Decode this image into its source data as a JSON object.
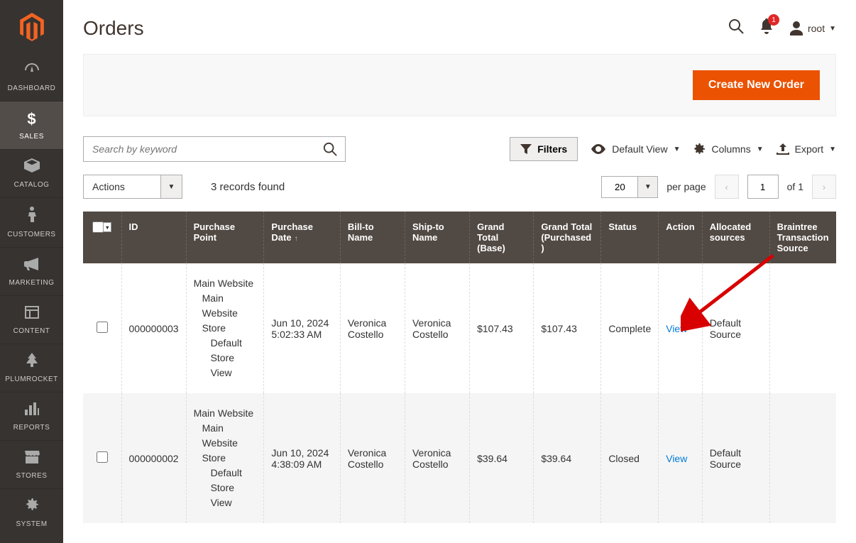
{
  "sidebar": {
    "items": [
      {
        "label": "DASHBOARD",
        "icon": "dashboard"
      },
      {
        "label": "SALES",
        "icon": "dollar",
        "active": true
      },
      {
        "label": "CATALOG",
        "icon": "box"
      },
      {
        "label": "CUSTOMERS",
        "icon": "person"
      },
      {
        "label": "MARKETING",
        "icon": "megaphone"
      },
      {
        "label": "CONTENT",
        "icon": "layout"
      },
      {
        "label": "PLUMROCKET",
        "icon": "tree"
      },
      {
        "label": "REPORTS",
        "icon": "bars"
      },
      {
        "label": "STORES",
        "icon": "storefront"
      },
      {
        "label": "SYSTEM",
        "icon": "gear"
      }
    ]
  },
  "header": {
    "title": "Orders",
    "notifications": "1",
    "user": "root"
  },
  "action_bar": {
    "create_label": "Create New Order"
  },
  "toolbar": {
    "search_placeholder": "Search by keyword",
    "filters_label": "Filters",
    "default_view_label": "Default View",
    "columns_label": "Columns",
    "export_label": "Export"
  },
  "meta": {
    "actions_label": "Actions",
    "records_found": "3 records found",
    "page_size": "20",
    "per_page_label": "per page",
    "current_page": "1",
    "of_label": "of 1"
  },
  "table": {
    "columns": [
      "ID",
      "Purchase Point",
      "Purchase Date",
      "Bill-to Name",
      "Ship-to Name",
      "Grand Total (Base)",
      "Grand Total (Purchased)",
      "Status",
      "Action",
      "Allocated sources",
      "Braintree Transaction Source"
    ],
    "sorted_col": 2,
    "rows": [
      {
        "id": "000000003",
        "purchase_point": {
          "l1": "Main Website",
          "l2": "Main Website Store",
          "l3": "Default Store View"
        },
        "date": "Jun 10, 2024 5:02:33 AM",
        "bill_to": "Veronica Costello",
        "ship_to": "Veronica Costello",
        "gt_base": "$107.43",
        "gt_purchased": "$107.43",
        "status": "Complete",
        "action": "View",
        "allocated": "Default Source",
        "braintree": ""
      },
      {
        "id": "000000002",
        "purchase_point": {
          "l1": "Main Website",
          "l2": "Main Website Store",
          "l3": "Default Store View"
        },
        "date": "Jun 10, 2024 4:38:09 AM",
        "bill_to": "Veronica Costello",
        "ship_to": "Veronica Costello",
        "gt_base": "$39.64",
        "gt_purchased": "$39.64",
        "status": "Closed",
        "action": "View",
        "allocated": "Default Source",
        "braintree": ""
      }
    ]
  }
}
